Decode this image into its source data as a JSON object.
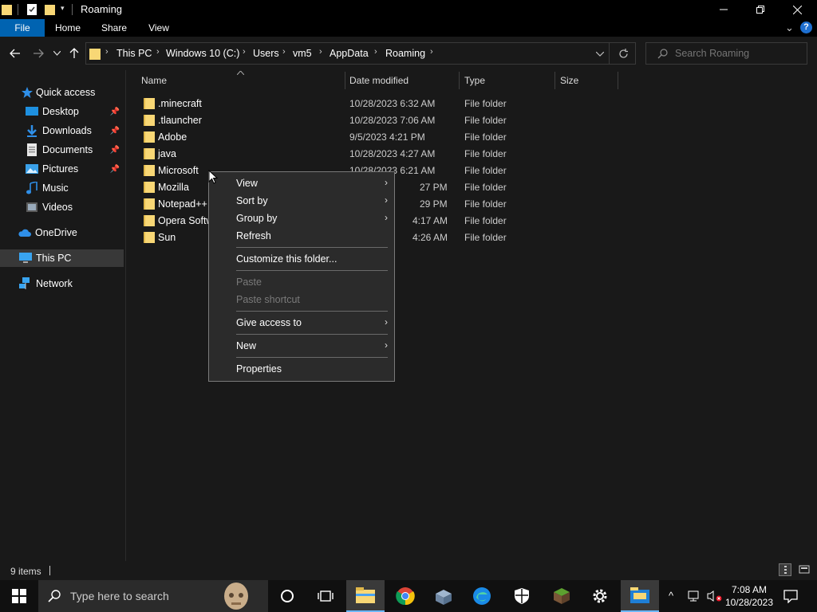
{
  "window": {
    "title": "Roaming"
  },
  "ribbon": {
    "tabs": [
      "File",
      "Home",
      "Share",
      "View"
    ],
    "active_tab": "File",
    "accent": "#0063b1"
  },
  "address": {
    "crumbs": [
      "This PC",
      "Windows 10 (C:)",
      "Users",
      "vm5",
      "AppData",
      "Roaming"
    ]
  },
  "search": {
    "placeholder": "Search Roaming"
  },
  "nav": {
    "quick_access": "Quick access",
    "items": [
      "Desktop",
      "Downloads",
      "Documents",
      "Pictures",
      "Music",
      "Videos"
    ],
    "onedrive": "OneDrive",
    "thispc": "This PC",
    "network": "Network"
  },
  "columns": {
    "name": "Name",
    "date": "Date modified",
    "type": "Type",
    "size": "Size"
  },
  "files": [
    {
      "name": ".minecraft",
      "date": "10/28/2023 6:32 AM",
      "type": "File folder"
    },
    {
      "name": ".tlauncher",
      "date": "10/28/2023 7:06 AM",
      "type": "File folder"
    },
    {
      "name": "Adobe",
      "date": "9/5/2023 4:21 PM",
      "type": "File folder"
    },
    {
      "name": "java",
      "date": "10/28/2023 4:27 AM",
      "type": "File folder"
    },
    {
      "name": "Microsoft",
      "date": "10/28/2023 6:21 AM",
      "type": "File folder"
    },
    {
      "name": "Mozilla",
      "date": "27 PM",
      "type": "File folder"
    },
    {
      "name": "Notepad++",
      "date": "29 PM",
      "type": "File folder"
    },
    {
      "name": "Opera Softw",
      "date": "4:17 AM",
      "type": "File folder"
    },
    {
      "name": "Sun",
      "date": "4:26 AM",
      "type": "File folder"
    }
  ],
  "context_menu": {
    "view": "View",
    "sort_by": "Sort by",
    "group_by": "Group by",
    "refresh": "Refresh",
    "customize": "Customize this folder...",
    "paste": "Paste",
    "paste_shortcut": "Paste shortcut",
    "give_access": "Give access to",
    "new": "New",
    "properties": "Properties"
  },
  "status": {
    "count": "9 items"
  },
  "taskbar": {
    "search_placeholder": "Type here to search",
    "time": "7:08 AM",
    "date": "10/28/2023"
  }
}
